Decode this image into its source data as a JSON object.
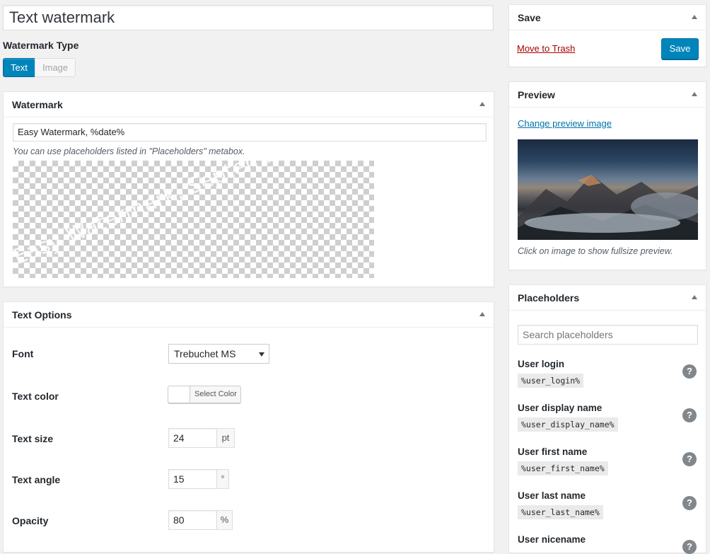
{
  "title": "Text watermark",
  "watermark_type": {
    "label": "Watermark Type",
    "options": [
      "Text",
      "Image"
    ],
    "selected": "Text"
  },
  "watermark_box": {
    "title": "Watermark",
    "text_value": "Easy Watermark, %date%",
    "hint": "You can use placeholders listed in \"Placeholders\" metabox.",
    "preview_text": "Easy Watermark, September 6, 2019"
  },
  "text_options": {
    "title": "Text Options",
    "font_label": "Font",
    "font_value": "Trebuchet MS",
    "color_label": "Text color",
    "color_button": "Select Color",
    "size_label": "Text size",
    "size_value": "24",
    "size_unit": "pt",
    "angle_label": "Text angle",
    "angle_value": "15",
    "angle_unit": "°",
    "opacity_label": "Opacity",
    "opacity_value": "80",
    "opacity_unit": "%"
  },
  "save_box": {
    "title": "Save",
    "trash": "Move to Trash",
    "save": "Save"
  },
  "preview_box": {
    "title": "Preview",
    "change_link": "Change preview image",
    "hint": "Click on image to show fullsize preview."
  },
  "placeholders_box": {
    "title": "Placeholders",
    "search_placeholder": "Search placeholders",
    "items": [
      {
        "name": "User login",
        "code": "%user_login%"
      },
      {
        "name": "User display name",
        "code": "%user_display_name%"
      },
      {
        "name": "User first name",
        "code": "%user_first_name%"
      },
      {
        "name": "User last name",
        "code": "%user_last_name%"
      },
      {
        "name": "User nicename",
        "code": ""
      }
    ],
    "help_glyph": "?"
  }
}
